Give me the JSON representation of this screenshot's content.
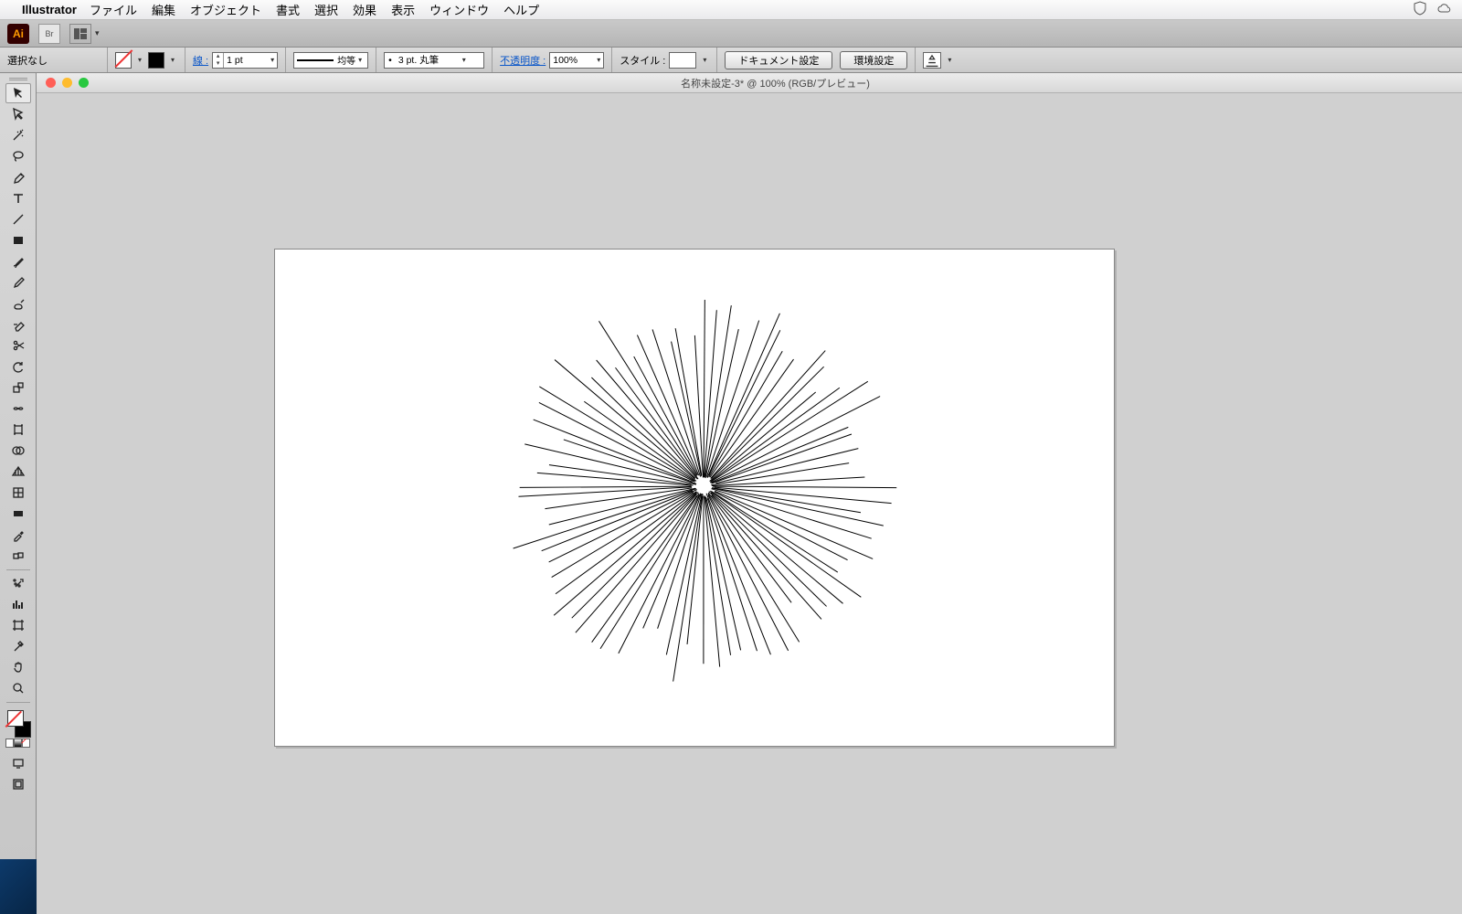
{
  "menubar": {
    "app_name": "Illustrator",
    "items": [
      "ファイル",
      "編集",
      "オブジェクト",
      "書式",
      "選択",
      "効果",
      "表示",
      "ウィンドウ",
      "ヘルプ"
    ]
  },
  "appbar": {
    "ai_badge": "Ai",
    "br_badge": "Br"
  },
  "control": {
    "selection_label": "選択なし",
    "stroke_label": "線 :",
    "weight_value": "1 pt",
    "profile_label": "均等",
    "brush_value": "3 pt. 丸筆",
    "opacity_label": "不透明度 :",
    "opacity_value": "100%",
    "style_label": "スタイル :",
    "doc_setup_btn": "ドキュメント設定",
    "prefs_btn": "環境設定"
  },
  "document": {
    "title": "名称未設定-3* @ 100% (RGB/プレビュー)"
  },
  "tools": [
    "selection",
    "direct-selection",
    "magic-wand",
    "lasso",
    "pen",
    "type",
    "line",
    "rectangle",
    "paintbrush",
    "pencil",
    "blob-brush",
    "scissors",
    "rotate",
    "scale",
    "width",
    "free-transform",
    "shape-builder",
    "perspective",
    "mesh",
    "gradient",
    "eyedropper",
    "blend",
    "symbol-sprayer",
    "column-graph",
    "artboard",
    "slice",
    "hand",
    "zoom"
  ]
}
